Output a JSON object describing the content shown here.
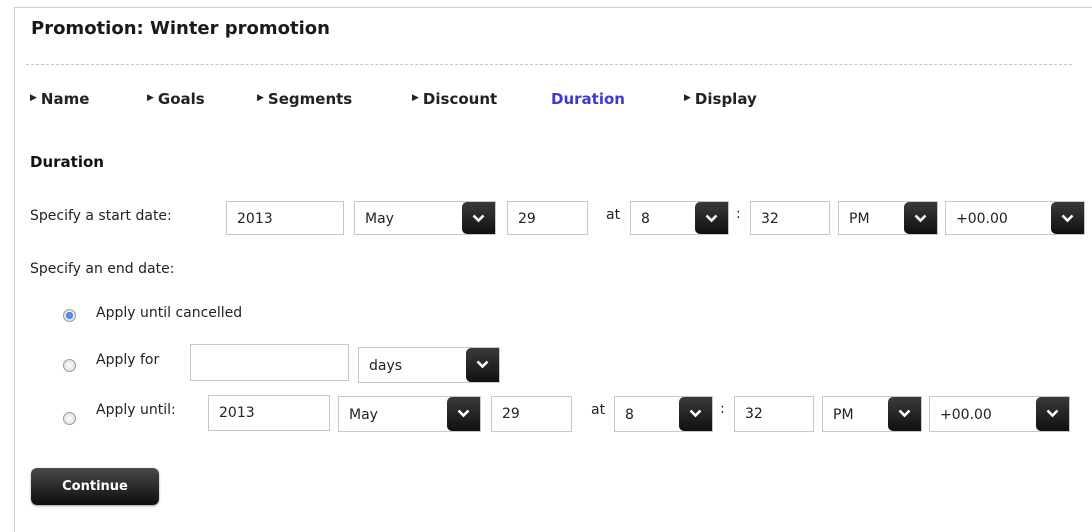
{
  "page": {
    "title": "Promotion: Winter promotion"
  },
  "steps": [
    {
      "label": "Name",
      "active": false
    },
    {
      "label": "Goals",
      "active": false
    },
    {
      "label": "Segments",
      "active": false
    },
    {
      "label": "Discount",
      "active": false
    },
    {
      "label": "Duration",
      "active": true
    },
    {
      "label": "Display",
      "active": false
    }
  ],
  "section": {
    "title": "Duration"
  },
  "start": {
    "label": "Specify a start date:",
    "year": "2013",
    "month": "May",
    "day": "29",
    "at_label": "at",
    "hour": "8",
    "colon": ":",
    "minute": "32",
    "ampm": "PM",
    "timezone": "+00.00"
  },
  "end": {
    "label": "Specify an end date:",
    "options": {
      "cancelled": {
        "label": "Apply until cancelled",
        "selected": true
      },
      "for": {
        "label": "Apply for",
        "value": "",
        "unit": "days",
        "selected": false
      },
      "until": {
        "label": "Apply until:",
        "selected": false,
        "year": "2013",
        "month": "May",
        "day": "29",
        "at_label": "at",
        "hour": "8",
        "colon": ":",
        "minute": "32",
        "ampm": "PM",
        "timezone": "+00.00"
      }
    }
  },
  "actions": {
    "continue_label": "Continue"
  },
  "colors": {
    "active_step": "#3b3bd1",
    "button_dark": "#111111"
  }
}
